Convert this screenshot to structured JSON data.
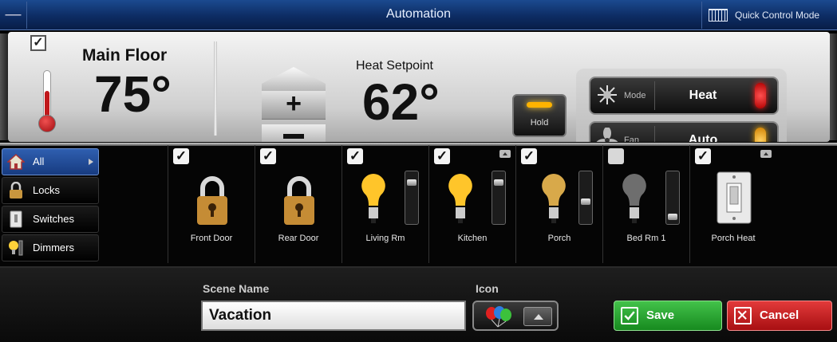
{
  "titlebar": {
    "menu_glyph": "—",
    "title": "Automation",
    "quick_control_mode": "Quick Control Mode"
  },
  "thermostat": {
    "enabled": true,
    "zone_name": "Main Floor",
    "current_temp": "75°",
    "setpoint_label": "Heat Setpoint",
    "setpoint_value": "62°",
    "plus_label": "+",
    "hold_label": "Hold",
    "mode": {
      "label": "Mode",
      "value": "Heat",
      "led_color": "#e01515"
    },
    "fan": {
      "label": "Fan",
      "value": "Auto",
      "led_color": "#ffb000"
    }
  },
  "filters": [
    {
      "label": "All",
      "icon": "home-icon",
      "active": true
    },
    {
      "label": "Locks",
      "icon": "lock-icon",
      "active": false
    },
    {
      "label": "Switches",
      "icon": "switch-icon",
      "active": false
    },
    {
      "label": "Dimmers",
      "icon": "bulb-icon",
      "active": false
    }
  ],
  "devices": [
    {
      "name": "Front Door",
      "type": "lock",
      "checked": true
    },
    {
      "name": "Rear Door",
      "type": "lock",
      "checked": true
    },
    {
      "name": "Living Rm",
      "type": "dimmer",
      "checked": true,
      "on": true,
      "level": 0.85
    },
    {
      "name": "Kitchen",
      "type": "dimmer",
      "checked": true,
      "on": true,
      "level": 0.85,
      "collapse": true
    },
    {
      "name": "Porch",
      "type": "dimmer",
      "checked": true,
      "on": true,
      "level": 0.4
    },
    {
      "name": "Bed Rm 1",
      "type": "dimmer",
      "checked": false,
      "on": false,
      "level": 0.05
    },
    {
      "name": "Porch Heat",
      "type": "switch",
      "checked": true,
      "collapse": true
    }
  ],
  "scene": {
    "name_label": "Scene Name",
    "name_value": "Vacation",
    "icon_label": "Icon",
    "icon": "balloons-icon"
  },
  "actions": {
    "save_label": "Save",
    "cancel_label": "Cancel"
  },
  "colors": {
    "titlebar": "#0d2c63",
    "active_filter": "#2f5fb0",
    "save": "#2aa832",
    "cancel": "#c81e22"
  }
}
